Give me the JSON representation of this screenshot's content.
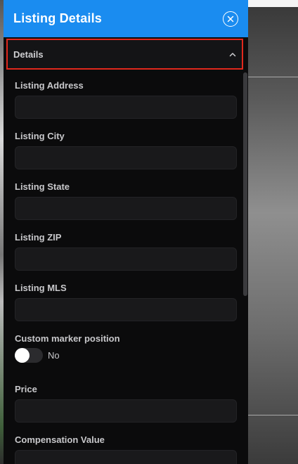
{
  "panel": {
    "title": "Listing Details",
    "header_color": "#1a8cf0",
    "close_icon": "close-circle-icon"
  },
  "section": {
    "title": "Details",
    "chevron_icon": "chevron-up-icon",
    "highlight_color": "#e1281c"
  },
  "fields": [
    {
      "label": "Listing Address",
      "value": ""
    },
    {
      "label": "Listing City",
      "value": ""
    },
    {
      "label": "Listing State",
      "value": ""
    },
    {
      "label": "Listing ZIP",
      "value": ""
    },
    {
      "label": "Listing MLS",
      "value": ""
    }
  ],
  "custom_marker": {
    "label": "Custom marker position",
    "toggle_state": "No"
  },
  "price": {
    "label": "Price",
    "value": ""
  },
  "compensation": {
    "label": "Compensation Value",
    "value": ""
  }
}
